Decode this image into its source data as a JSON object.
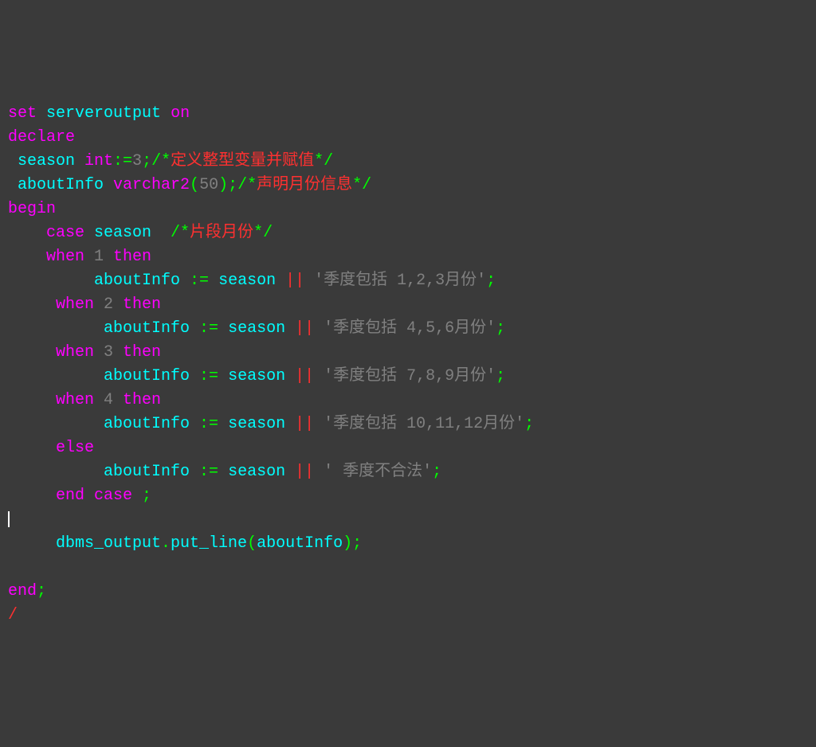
{
  "code": {
    "line1": {
      "set": "set",
      "serveroutput": "serveroutput",
      "on": "on"
    },
    "line2": {
      "declare": "declare"
    },
    "line3": {
      "season": " season ",
      "int": "int",
      "coloneq": ":=",
      "val": "3",
      "semi": ";",
      "cmt_open": "/*",
      "cmt_txt": "定义整型变量并赋值",
      "cmt_close": "*/"
    },
    "line4": {
      "aboutInfo": " aboutInfo ",
      "varchar2": "varchar2",
      "paren_o": "(",
      "size": "50",
      "paren_c": ")",
      "semi": ";",
      "cmt_open": "/*",
      "cmt_txt": "声明月份信息",
      "cmt_close": "*/"
    },
    "line5": {
      "begin": "begin"
    },
    "line6": {
      "case": "    case",
      "season": " season  ",
      "cmt_open": "/*",
      "cmt_txt": "片段月份",
      "cmt_close": "*/"
    },
    "line7": {
      "when": "    when",
      "num": " 1 ",
      "then": "then"
    },
    "line8": {
      "aboutInfo": "         aboutInfo ",
      "assign": ":=",
      "season": " season ",
      "concat": "||",
      "str": " '季度包括 1,2,3月份'",
      "semi": ";"
    },
    "line9": {
      "when": "     when",
      "num": " 2 ",
      "then": "then"
    },
    "line10": {
      "aboutInfo": "          aboutInfo ",
      "assign": ":=",
      "season": " season ",
      "concat": "||",
      "str": " '季度包括 4,5,6月份'",
      "semi": ";"
    },
    "line11": {
      "when": "     when",
      "num": " 3 ",
      "then": "then"
    },
    "line12": {
      "aboutInfo": "          aboutInfo ",
      "assign": ":=",
      "season": " season ",
      "concat": "||",
      "str": " '季度包括 7,8,9月份'",
      "semi": ";"
    },
    "line13": {
      "when": "     when",
      "num": " 4 ",
      "then": "then"
    },
    "line14": {
      "aboutInfo": "          aboutInfo ",
      "assign": ":=",
      "season": " season ",
      "concat": "||",
      "str": " '季度包括 10,11,12月份'",
      "semi": ";"
    },
    "line15": {
      "else": "     else"
    },
    "line16": {
      "aboutInfo": "          aboutInfo ",
      "assign": ":=",
      "season": " season ",
      "concat": "||",
      "str": " ' 季度不合法'",
      "semi": ";"
    },
    "line17": {
      "end": "     end",
      "case": " case ",
      "semi": ";"
    },
    "line18": {
      "dbms": "     dbms_output",
      "dot": ".",
      "putline": "put_line",
      "paren_o": "(",
      "arg": "aboutInfo",
      "paren_c": ")",
      "semi": ";"
    },
    "line19": {
      "end": "end",
      "semi": ";"
    },
    "line20": {
      "slash": "/"
    }
  }
}
